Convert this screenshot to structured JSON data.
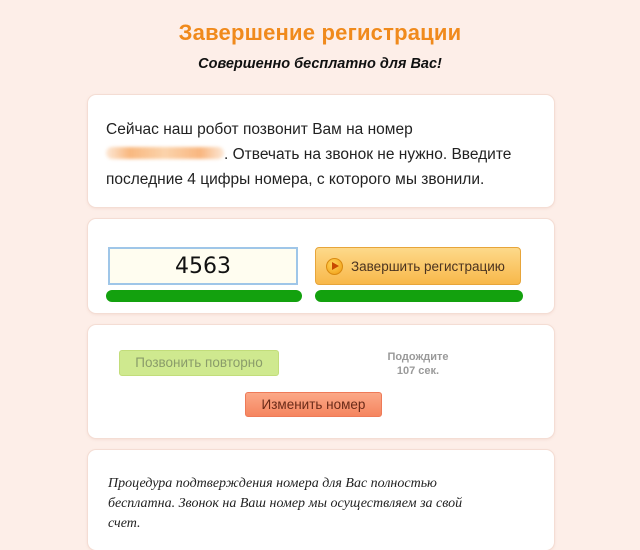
{
  "header": {
    "title": "Завершение регистрации",
    "subtitle": "Совершенно бесплатно для Вас!"
  },
  "info": {
    "line1": "Сейчас наш робот позвонит Вам на номер",
    "line2_after_phone": ". Отвечать на звонок не нужно. Введите",
    "line3": "последние 4 цифры номера, с которого мы звонили."
  },
  "form": {
    "code_value": "4563",
    "finish_button_label": "Завершить регистрацию",
    "finish_icon": "arrow-circle-icon",
    "progress": [
      1.0,
      1.0
    ]
  },
  "actions": {
    "recall_label": "Позвонить повторно",
    "wait_line1": "Подождите",
    "wait_line2": "107 сек.",
    "change_number_label": "Изменить номер"
  },
  "note": {
    "line1": "Процедура подтверждения номера для Вас полностью",
    "line2": "бесплатна. Звонок на Ваш номер мы осуществляем за свой",
    "line3": "счет."
  },
  "colors": {
    "background": "#fdeee8",
    "title": "#f08a1c",
    "progress_green": "#13a10e",
    "finish_button": "#f8b84a",
    "recall_button": "#cfe98f",
    "change_button": "#f5855f"
  }
}
